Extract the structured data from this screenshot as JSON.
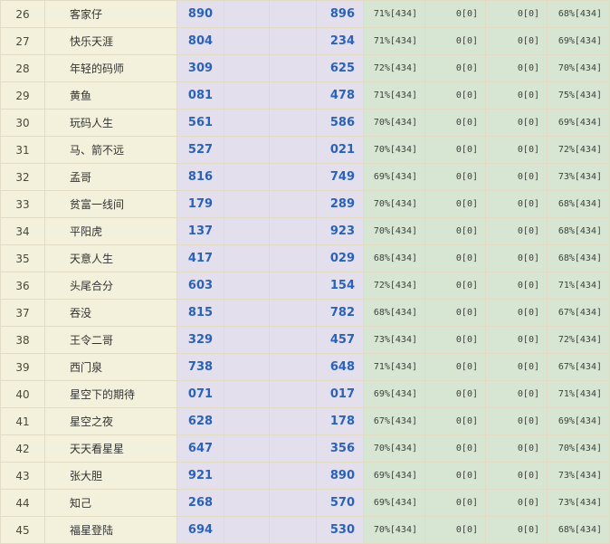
{
  "rows": [
    {
      "rank": "26",
      "name": "客家仔",
      "n1": "890",
      "n2": "896",
      "s1": "71%[434]",
      "s2": "0[0]",
      "s3": "0[0]",
      "s4": "68%[434]"
    },
    {
      "rank": "27",
      "name": "快乐天涯",
      "n1": "804",
      "n2": "234",
      "s1": "71%[434]",
      "s2": "0[0]",
      "s3": "0[0]",
      "s4": "69%[434]"
    },
    {
      "rank": "28",
      "name": "年轻的码师",
      "n1": "309",
      "n2": "625",
      "s1": "72%[434]",
      "s2": "0[0]",
      "s3": "0[0]",
      "s4": "70%[434]"
    },
    {
      "rank": "29",
      "name": "黄鱼",
      "n1": "081",
      "n2": "478",
      "s1": "71%[434]",
      "s2": "0[0]",
      "s3": "0[0]",
      "s4": "75%[434]"
    },
    {
      "rank": "30",
      "name": "玩码人生",
      "n1": "561",
      "n2": "586",
      "s1": "70%[434]",
      "s2": "0[0]",
      "s3": "0[0]",
      "s4": "69%[434]"
    },
    {
      "rank": "31",
      "name": "马、箭不远",
      "n1": "527",
      "n2": "021",
      "s1": "70%[434]",
      "s2": "0[0]",
      "s3": "0[0]",
      "s4": "72%[434]"
    },
    {
      "rank": "32",
      "name": "孟哥",
      "n1": "816",
      "n2": "749",
      "s1": "69%[434]",
      "s2": "0[0]",
      "s3": "0[0]",
      "s4": "73%[434]"
    },
    {
      "rank": "33",
      "name": "贫富一线间",
      "n1": "179",
      "n2": "289",
      "s1": "70%[434]",
      "s2": "0[0]",
      "s3": "0[0]",
      "s4": "68%[434]"
    },
    {
      "rank": "34",
      "name": "平阳虎",
      "n1": "137",
      "n2": "923",
      "s1": "70%[434]",
      "s2": "0[0]",
      "s3": "0[0]",
      "s4": "68%[434]"
    },
    {
      "rank": "35",
      "name": "天意人生",
      "n1": "417",
      "n2": "029",
      "s1": "68%[434]",
      "s2": "0[0]",
      "s3": "0[0]",
      "s4": "68%[434]"
    },
    {
      "rank": "36",
      "name": "头尾合分",
      "n1": "603",
      "n2": "154",
      "s1": "72%[434]",
      "s2": "0[0]",
      "s3": "0[0]",
      "s4": "71%[434]"
    },
    {
      "rank": "37",
      "name": "吞没",
      "n1": "815",
      "n2": "782",
      "s1": "68%[434]",
      "s2": "0[0]",
      "s3": "0[0]",
      "s4": "67%[434]"
    },
    {
      "rank": "38",
      "name": "王令二哥",
      "n1": "329",
      "n2": "457",
      "s1": "73%[434]",
      "s2": "0[0]",
      "s3": "0[0]",
      "s4": "72%[434]"
    },
    {
      "rank": "39",
      "name": "西门泉",
      "n1": "738",
      "n2": "648",
      "s1": "71%[434]",
      "s2": "0[0]",
      "s3": "0[0]",
      "s4": "67%[434]"
    },
    {
      "rank": "40",
      "name": "星空下的期待",
      "n1": "071",
      "n2": "017",
      "s1": "69%[434]",
      "s2": "0[0]",
      "s3": "0[0]",
      "s4": "71%[434]"
    },
    {
      "rank": "41",
      "name": "星空之夜",
      "n1": "628",
      "n2": "178",
      "s1": "67%[434]",
      "s2": "0[0]",
      "s3": "0[0]",
      "s4": "69%[434]"
    },
    {
      "rank": "42",
      "name": "天天看星星",
      "n1": "647",
      "n2": "356",
      "s1": "70%[434]",
      "s2": "0[0]",
      "s3": "0[0]",
      "s4": "70%[434]"
    },
    {
      "rank": "43",
      "name": "张大胆",
      "n1": "921",
      "n2": "890",
      "s1": "69%[434]",
      "s2": "0[0]",
      "s3": "0[0]",
      "s4": "73%[434]"
    },
    {
      "rank": "44",
      "name": "知己",
      "n1": "268",
      "n2": "570",
      "s1": "69%[434]",
      "s2": "0[0]",
      "s3": "0[0]",
      "s4": "73%[434]"
    },
    {
      "rank": "45",
      "name": "福星登陆",
      "n1": "694",
      "n2": "530",
      "s1": "70%[434]",
      "s2": "0[0]",
      "s3": "0[0]",
      "s4": "68%[434]"
    }
  ]
}
